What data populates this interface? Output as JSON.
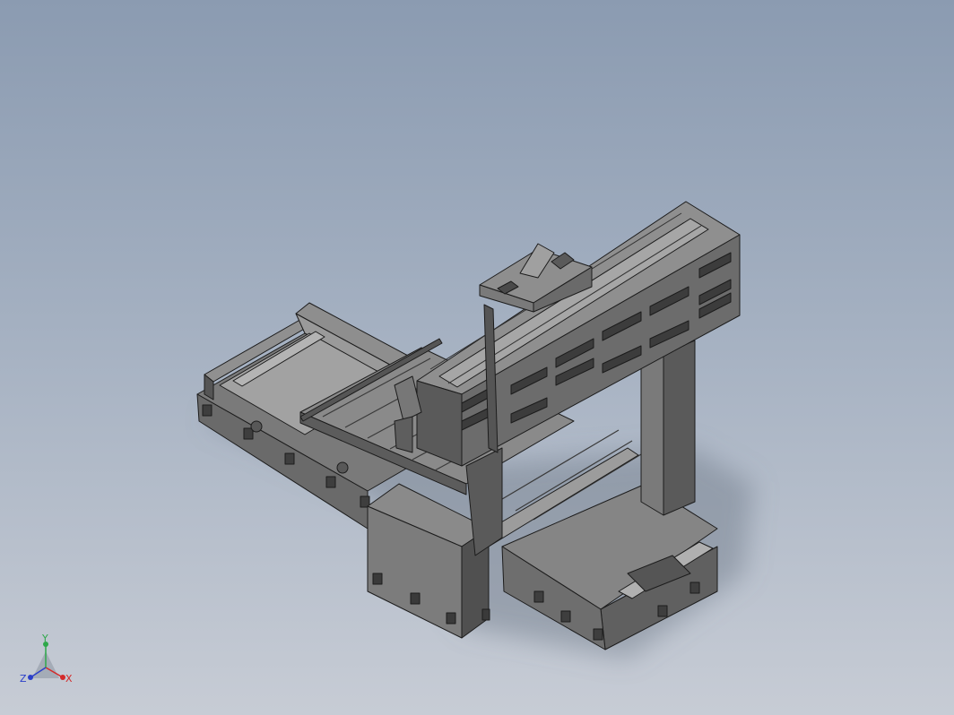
{
  "viewport": {
    "background_top": "#8b9bb1",
    "background_bottom": "#c7ccd5"
  },
  "model": {
    "shade_light": "#8c8c8c",
    "shade_mid": "#6f6f6f",
    "shade_dark": "#4e4e4e",
    "edge": "#1c1c1c"
  },
  "triad": {
    "x_label": "X",
    "y_label": "Y",
    "z_label": "Z",
    "x_color": "#d42a2a",
    "y_color": "#2ea84a",
    "z_color": "#2b3fc9"
  }
}
